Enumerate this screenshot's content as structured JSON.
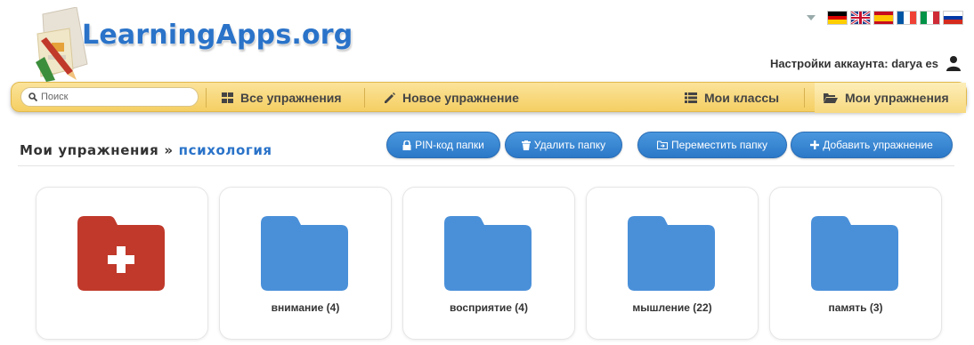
{
  "header": {
    "logo_text": "LearningApps.org",
    "account_text": "Настройки аккаунта: darya es"
  },
  "languages": [
    "de",
    "en",
    "es",
    "fr",
    "it",
    "ru"
  ],
  "nav": {
    "search_placeholder": "Поиск",
    "all_exercises": "Все упражнения",
    "new_exercise": "Новое упражнение",
    "my_classes": "Мои классы",
    "my_exercises": "Мои упражнения"
  },
  "breadcrumb": {
    "root": "Мои упражнения",
    "separator": "»",
    "current": "психология"
  },
  "actions": {
    "pin": "PIN-код папки",
    "delete": "Удалить папку",
    "move": "Переместить папку",
    "add": "Добавить упражнение"
  },
  "folders": [
    {
      "label": "",
      "type": "new-folder",
      "color": "#c0392b"
    },
    {
      "label": "внимание (4)",
      "type": "folder",
      "color": "#4a90d9"
    },
    {
      "label": "восприятие (4)",
      "type": "folder",
      "color": "#4a90d9"
    },
    {
      "label": "мышление (22)",
      "type": "folder",
      "color": "#4a90d9"
    },
    {
      "label": "память (3)",
      "type": "folder",
      "color": "#4a90d9"
    }
  ],
  "colors": {
    "accent": "#2a73c9",
    "nav_bar": "#f5cf63",
    "new_folder": "#c0392b",
    "folder": "#4a90d9"
  }
}
